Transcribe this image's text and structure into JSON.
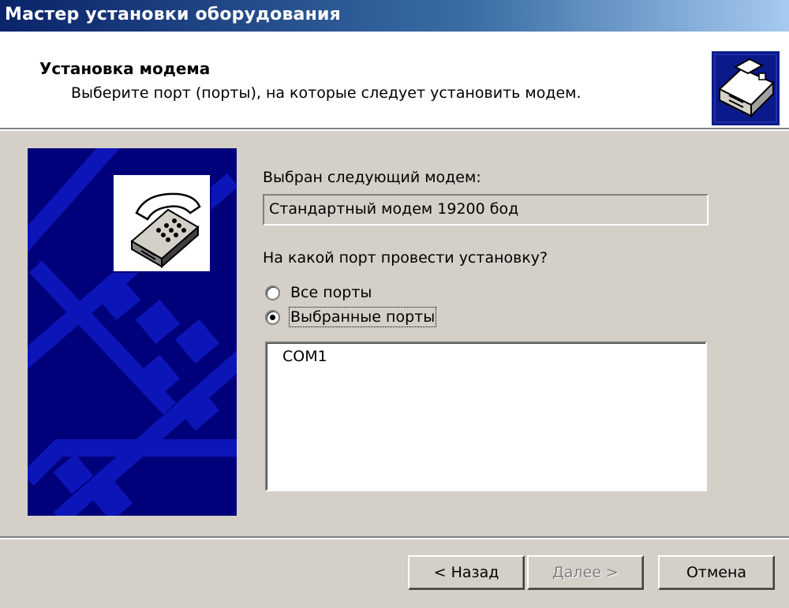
{
  "window": {
    "title": "Мастер установки оборудования"
  },
  "header": {
    "title": "Установка модема",
    "subtitle": "Выберите порт (порты), на которые следует установить модем.",
    "icon": "hardware-icon"
  },
  "side_panel": {
    "icon": "telephone-icon"
  },
  "modem": {
    "label": "Выбран следующий модем:",
    "value": "Стандартный модем 19200 бод"
  },
  "port_question": "На какой порт провести установку?",
  "options": {
    "all_ports": {
      "label": "Все порты",
      "checked": false
    },
    "selected_ports": {
      "label": "Выбранные порты",
      "checked": true
    }
  },
  "ports_list": [
    "COM1"
  ],
  "buttons": {
    "back": "< Назад",
    "next": "Далее >",
    "cancel": "Отмена"
  }
}
